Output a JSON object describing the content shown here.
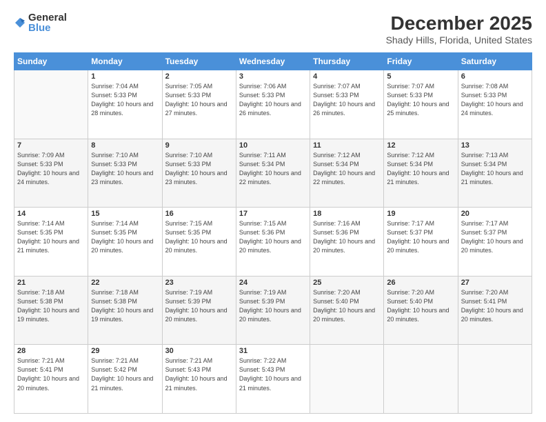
{
  "logo": {
    "general": "General",
    "blue": "Blue"
  },
  "title": "December 2025",
  "location": "Shady Hills, Florida, United States",
  "days": [
    "Sunday",
    "Monday",
    "Tuesday",
    "Wednesday",
    "Thursday",
    "Friday",
    "Saturday"
  ],
  "weeks": [
    [
      {
        "date": "",
        "sunrise": "",
        "sunset": "",
        "daylight": ""
      },
      {
        "date": "1",
        "sunrise": "Sunrise: 7:04 AM",
        "sunset": "Sunset: 5:33 PM",
        "daylight": "Daylight: 10 hours and 28 minutes."
      },
      {
        "date": "2",
        "sunrise": "Sunrise: 7:05 AM",
        "sunset": "Sunset: 5:33 PM",
        "daylight": "Daylight: 10 hours and 27 minutes."
      },
      {
        "date": "3",
        "sunrise": "Sunrise: 7:06 AM",
        "sunset": "Sunset: 5:33 PM",
        "daylight": "Daylight: 10 hours and 26 minutes."
      },
      {
        "date": "4",
        "sunrise": "Sunrise: 7:07 AM",
        "sunset": "Sunset: 5:33 PM",
        "daylight": "Daylight: 10 hours and 26 minutes."
      },
      {
        "date": "5",
        "sunrise": "Sunrise: 7:07 AM",
        "sunset": "Sunset: 5:33 PM",
        "daylight": "Daylight: 10 hours and 25 minutes."
      },
      {
        "date": "6",
        "sunrise": "Sunrise: 7:08 AM",
        "sunset": "Sunset: 5:33 PM",
        "daylight": "Daylight: 10 hours and 24 minutes."
      }
    ],
    [
      {
        "date": "7",
        "sunrise": "Sunrise: 7:09 AM",
        "sunset": "Sunset: 5:33 PM",
        "daylight": "Daylight: 10 hours and 24 minutes."
      },
      {
        "date": "8",
        "sunrise": "Sunrise: 7:10 AM",
        "sunset": "Sunset: 5:33 PM",
        "daylight": "Daylight: 10 hours and 23 minutes."
      },
      {
        "date": "9",
        "sunrise": "Sunrise: 7:10 AM",
        "sunset": "Sunset: 5:33 PM",
        "daylight": "Daylight: 10 hours and 23 minutes."
      },
      {
        "date": "10",
        "sunrise": "Sunrise: 7:11 AM",
        "sunset": "Sunset: 5:34 PM",
        "daylight": "Daylight: 10 hours and 22 minutes."
      },
      {
        "date": "11",
        "sunrise": "Sunrise: 7:12 AM",
        "sunset": "Sunset: 5:34 PM",
        "daylight": "Daylight: 10 hours and 22 minutes."
      },
      {
        "date": "12",
        "sunrise": "Sunrise: 7:12 AM",
        "sunset": "Sunset: 5:34 PM",
        "daylight": "Daylight: 10 hours and 21 minutes."
      },
      {
        "date": "13",
        "sunrise": "Sunrise: 7:13 AM",
        "sunset": "Sunset: 5:34 PM",
        "daylight": "Daylight: 10 hours and 21 minutes."
      }
    ],
    [
      {
        "date": "14",
        "sunrise": "Sunrise: 7:14 AM",
        "sunset": "Sunset: 5:35 PM",
        "daylight": "Daylight: 10 hours and 21 minutes."
      },
      {
        "date": "15",
        "sunrise": "Sunrise: 7:14 AM",
        "sunset": "Sunset: 5:35 PM",
        "daylight": "Daylight: 10 hours and 20 minutes."
      },
      {
        "date": "16",
        "sunrise": "Sunrise: 7:15 AM",
        "sunset": "Sunset: 5:35 PM",
        "daylight": "Daylight: 10 hours and 20 minutes."
      },
      {
        "date": "17",
        "sunrise": "Sunrise: 7:15 AM",
        "sunset": "Sunset: 5:36 PM",
        "daylight": "Daylight: 10 hours and 20 minutes."
      },
      {
        "date": "18",
        "sunrise": "Sunrise: 7:16 AM",
        "sunset": "Sunset: 5:36 PM",
        "daylight": "Daylight: 10 hours and 20 minutes."
      },
      {
        "date": "19",
        "sunrise": "Sunrise: 7:17 AM",
        "sunset": "Sunset: 5:37 PM",
        "daylight": "Daylight: 10 hours and 20 minutes."
      },
      {
        "date": "20",
        "sunrise": "Sunrise: 7:17 AM",
        "sunset": "Sunset: 5:37 PM",
        "daylight": "Daylight: 10 hours and 20 minutes."
      }
    ],
    [
      {
        "date": "21",
        "sunrise": "Sunrise: 7:18 AM",
        "sunset": "Sunset: 5:38 PM",
        "daylight": "Daylight: 10 hours and 19 minutes."
      },
      {
        "date": "22",
        "sunrise": "Sunrise: 7:18 AM",
        "sunset": "Sunset: 5:38 PM",
        "daylight": "Daylight: 10 hours and 19 minutes."
      },
      {
        "date": "23",
        "sunrise": "Sunrise: 7:19 AM",
        "sunset": "Sunset: 5:39 PM",
        "daylight": "Daylight: 10 hours and 20 minutes."
      },
      {
        "date": "24",
        "sunrise": "Sunrise: 7:19 AM",
        "sunset": "Sunset: 5:39 PM",
        "daylight": "Daylight: 10 hours and 20 minutes."
      },
      {
        "date": "25",
        "sunrise": "Sunrise: 7:20 AM",
        "sunset": "Sunset: 5:40 PM",
        "daylight": "Daylight: 10 hours and 20 minutes."
      },
      {
        "date": "26",
        "sunrise": "Sunrise: 7:20 AM",
        "sunset": "Sunset: 5:40 PM",
        "daylight": "Daylight: 10 hours and 20 minutes."
      },
      {
        "date": "27",
        "sunrise": "Sunrise: 7:20 AM",
        "sunset": "Sunset: 5:41 PM",
        "daylight": "Daylight: 10 hours and 20 minutes."
      }
    ],
    [
      {
        "date": "28",
        "sunrise": "Sunrise: 7:21 AM",
        "sunset": "Sunset: 5:41 PM",
        "daylight": "Daylight: 10 hours and 20 minutes."
      },
      {
        "date": "29",
        "sunrise": "Sunrise: 7:21 AM",
        "sunset": "Sunset: 5:42 PM",
        "daylight": "Daylight: 10 hours and 21 minutes."
      },
      {
        "date": "30",
        "sunrise": "Sunrise: 7:21 AM",
        "sunset": "Sunset: 5:43 PM",
        "daylight": "Daylight: 10 hours and 21 minutes."
      },
      {
        "date": "31",
        "sunrise": "Sunrise: 7:22 AM",
        "sunset": "Sunset: 5:43 PM",
        "daylight": "Daylight: 10 hours and 21 minutes."
      },
      {
        "date": "",
        "sunrise": "",
        "sunset": "",
        "daylight": ""
      },
      {
        "date": "",
        "sunrise": "",
        "sunset": "",
        "daylight": ""
      },
      {
        "date": "",
        "sunrise": "",
        "sunset": "",
        "daylight": ""
      }
    ]
  ]
}
